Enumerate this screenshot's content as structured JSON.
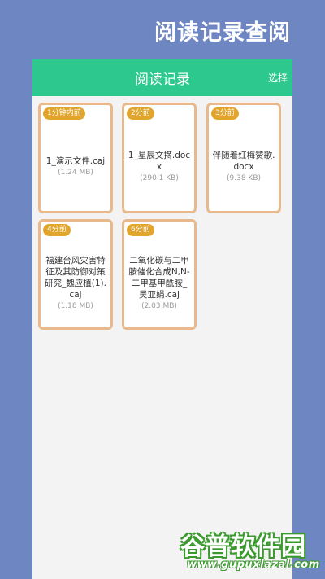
{
  "hero": {
    "title": "阅读记录查阅"
  },
  "header": {
    "title": "阅读记录",
    "select_label": "选择"
  },
  "records": [
    {
      "time": "1分钟内前",
      "name": "1_演示文件.caj",
      "size": "(1.24 MB)"
    },
    {
      "time": "2分前",
      "name": "1_星辰文摘.docx",
      "size": "(290.1 KB)"
    },
    {
      "time": "3分前",
      "name": "伴随着红梅赞歌.docx",
      "size": "(9.38 KB)"
    },
    {
      "time": "4分前",
      "name": "福建台风灾害特征及其防御对策研究_魏应植(1).caj",
      "size": "(1.18 MB)"
    },
    {
      "time": "6分前",
      "name": "二氧化碳与二甲胺催化合成N,N-二甲基甲酰胺_吴亚娟.caj",
      "size": "(2.03 MB)"
    }
  ],
  "watermark": {
    "text": "谷普软件园",
    "url": "www.gupuxlazal.com"
  },
  "colors": {
    "accent": "#2cc88e",
    "badge": "#e2a52b",
    "card_border": "#e7b98c",
    "background": "#6e86c2"
  }
}
